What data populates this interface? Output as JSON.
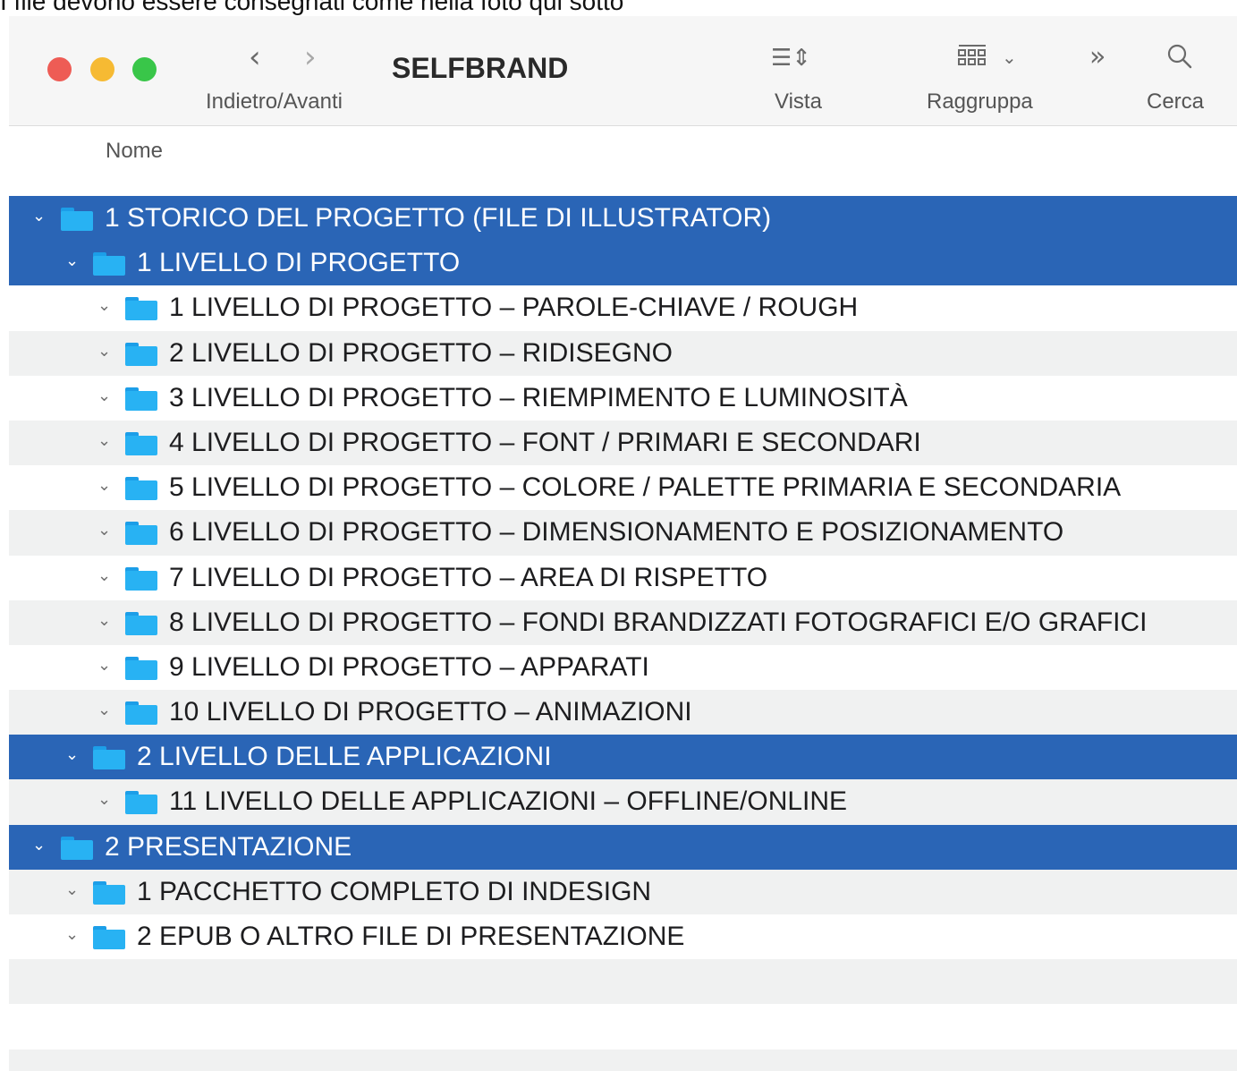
{
  "caption": "I file devono essere consegnati come nella foto qui sotto",
  "window": {
    "title": "SELFBRAND",
    "nav_label": "Indietro/Avanti",
    "view_label": "Vista",
    "group_label": "Raggruppa",
    "search_label": "Cerca",
    "icons": {
      "back": "chevron-left-icon",
      "forward": "chevron-right-icon",
      "view": "list-view-icon",
      "group": "grid-group-icon",
      "more": "double-chevron-icon",
      "search": "magnifier-icon"
    }
  },
  "column_header": "Nome",
  "colors": {
    "selection": "#2a65b6",
    "alternate_row": "#f0f1f1",
    "folder": "#28b2f3"
  },
  "rows": [
    {
      "label": "1 STORICO DEL PROGETTO (FILE DI ILLUSTRATOR)",
      "level": 0,
      "selected": true
    },
    {
      "label": "1 LIVELLO DI PROGETTO",
      "level": 1,
      "selected": true
    },
    {
      "label": "1 LIVELLO DI PROGETTO – PAROLE-CHIAVE / ROUGH",
      "level": 2,
      "selected": false
    },
    {
      "label": "2 LIVELLO DI PROGETTO – RIDISEGNO",
      "level": 2,
      "selected": false
    },
    {
      "label": "3 LIVELLO DI PROGETTO – RIEMPIMENTO E LUMINOSITÀ",
      "level": 2,
      "selected": false
    },
    {
      "label": "4 LIVELLO DI PROGETTO – FONT / PRIMARI E SECONDARI",
      "level": 2,
      "selected": false
    },
    {
      "label": "5 LIVELLO DI PROGETTO – COLORE / PALETTE PRIMARIA E SECONDARIA",
      "level": 2,
      "selected": false
    },
    {
      "label": "6 LIVELLO DI PROGETTO – DIMENSIONAMENTO E POSIZIONAMENTO",
      "level": 2,
      "selected": false
    },
    {
      "label": "7 LIVELLO DI PROGETTO – AREA DI RISPETTO",
      "level": 2,
      "selected": false
    },
    {
      "label": "8 LIVELLO DI PROGETTO – FONDI BRANDIZZATI FOTOGRAFICI E/O GRAFICI",
      "level": 2,
      "selected": false
    },
    {
      "label": "9 LIVELLO DI PROGETTO – APPARATI",
      "level": 2,
      "selected": false
    },
    {
      "label": "10 LIVELLO DI PROGETTO – ANIMAZIONI",
      "level": 2,
      "selected": false
    },
    {
      "label": "2 LIVELLO DELLE APPLICAZIONI",
      "level": 1,
      "selected": true
    },
    {
      "label": "11 LIVELLO DELLE APPLICAZIONI – OFFLINE/ONLINE",
      "level": 2,
      "selected": false
    },
    {
      "label": "2 PRESENTAZIONE",
      "level": 0,
      "selected": true
    },
    {
      "label": "1 PACCHETTO COMPLETO DI INDESIGN",
      "level": 1,
      "selected": false
    },
    {
      "label": "2 EPUB O ALTRO FILE DI PRESENTAZIONE",
      "level": 1,
      "selected": false
    }
  ]
}
